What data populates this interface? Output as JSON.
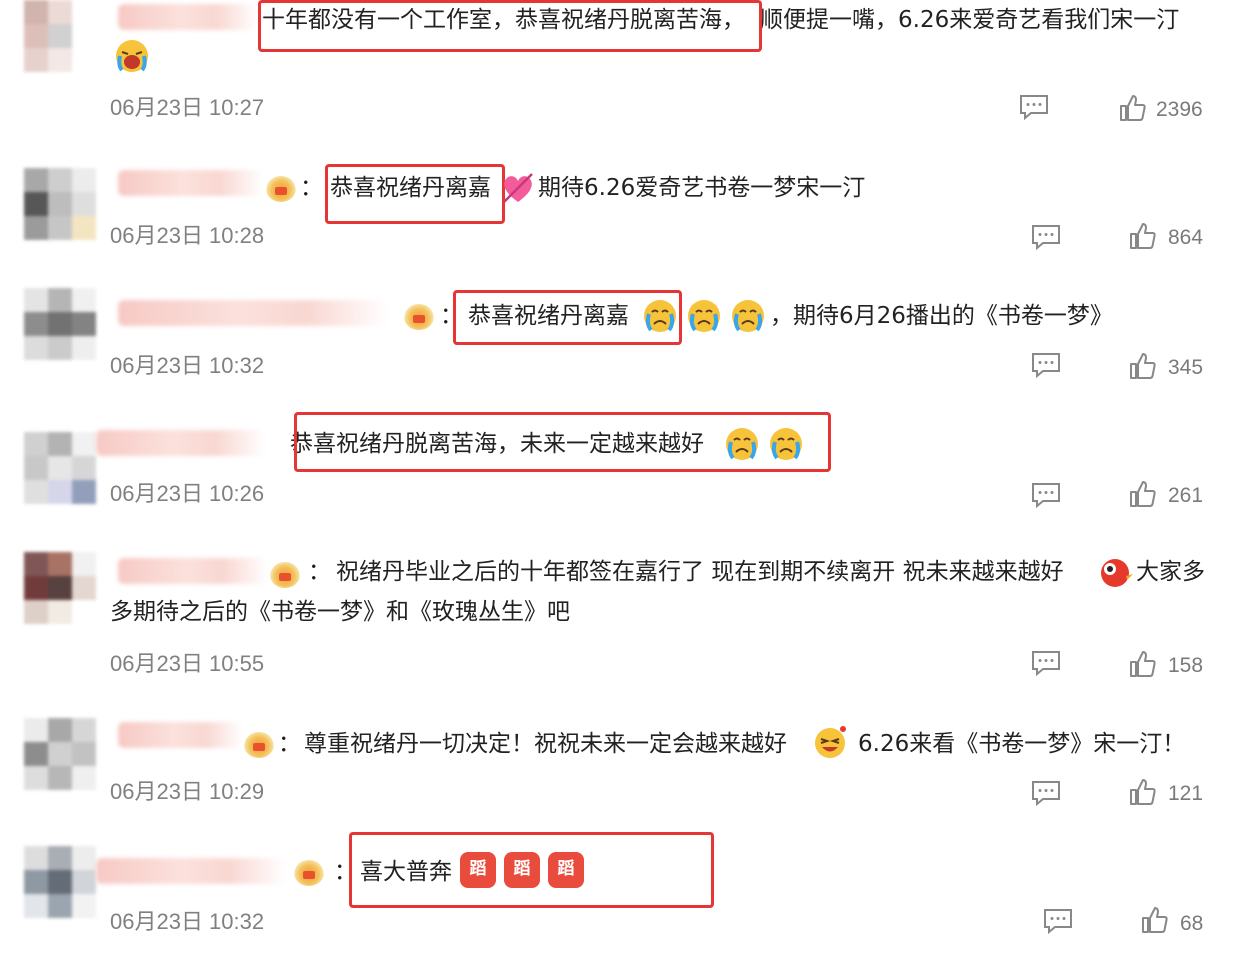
{
  "comments": [
    {
      "text_before": "十年都没有一个工作室，恭喜祝绪丹脱离苦海，",
      "text_after": "顺便提一嘴，6.26来爱奇艺看我们宋一汀",
      "time": "06月23日 10:27",
      "likes": "2396",
      "emoji": "crying-face-emoji"
    },
    {
      "prefix": "：",
      "text_hl": "恭喜祝绪丹离嘉",
      "text_after": "期待6.26爱奇艺书卷一梦宋一汀",
      "time": "06月23日 10:28",
      "likes": "864"
    },
    {
      "prefix": "：",
      "text_hl": "恭喜祝绪丹离嘉",
      "text_after": "，期待6月26播出的《书卷一梦》",
      "time": "06月23日 10:32",
      "likes": "345"
    },
    {
      "text_hl": "恭喜祝绪丹脱离苦海，未来一定越来越好",
      "time": "06月23日 10:26",
      "likes": "261"
    },
    {
      "prefix": "：",
      "line1": "祝绪丹毕业之后的十年都签在嘉行了 现在到期不续离开 祝未来越来越好",
      "line1_tail": "大家多",
      "line2": "多期待之后的《书卷一梦》和《玫瑰丛生》吧",
      "time": "06月23日 10:55",
      "likes": "158"
    },
    {
      "prefix": "：",
      "text_before": "尊重祝绪丹一切决定！祝祝未来一定会越来越好",
      "text_after": "6.26来看《书卷一梦》宋一汀！",
      "time": "06月23日 10:29",
      "likes": "121"
    },
    {
      "prefix": "：",
      "text_hl": "喜大普奔",
      "badge_char": "蹈",
      "time": "06月23日 10:32",
      "likes": "68"
    }
  ],
  "colors": {
    "highlight": "#e53535",
    "time": "#808080",
    "count": "#7a7a7a"
  }
}
